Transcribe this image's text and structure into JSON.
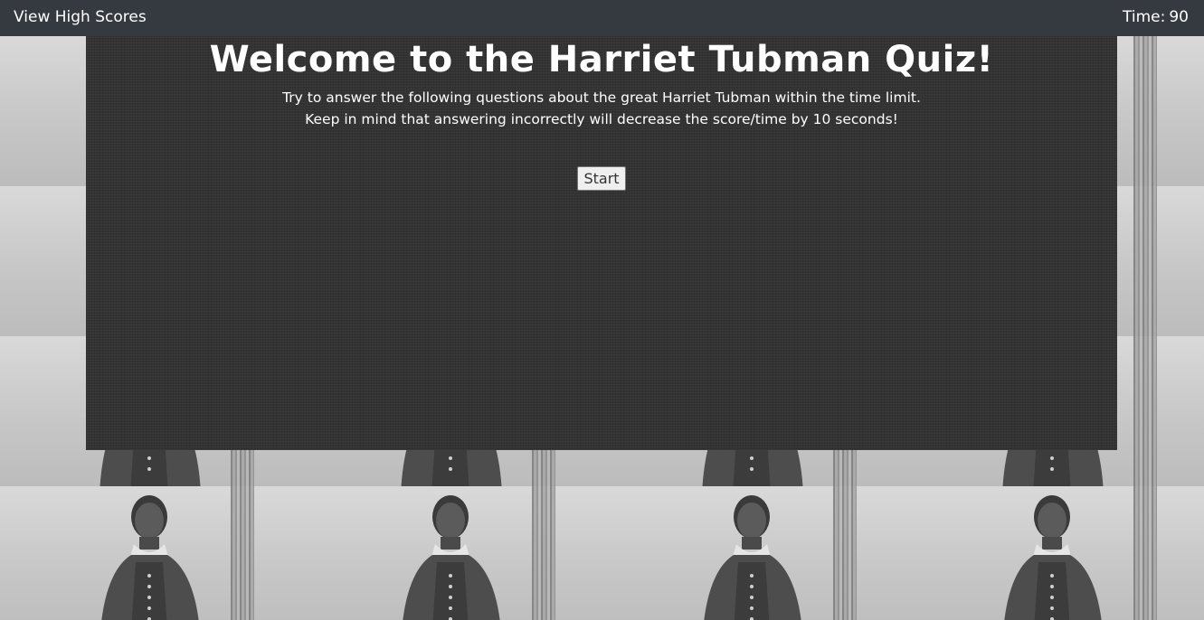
{
  "topbar": {
    "high_scores_link": "View High Scores",
    "timer_label": "Time:",
    "timer_value": "90"
  },
  "main": {
    "title": "Welcome to the Harriet Tubman Quiz!",
    "intro_line1": "Try to answer the following questions about the great Harriet Tubman within the time limit.",
    "intro_line2": "Keep in mind that answering incorrectly will decrease the score/time by 10 seconds!",
    "start_label": "Start"
  },
  "colors": {
    "topbar_bg": "#343a40",
    "panel_bg": "#333333",
    "text": "#ffffff"
  },
  "background": {
    "image_subject": "portrait-photo-icon"
  }
}
